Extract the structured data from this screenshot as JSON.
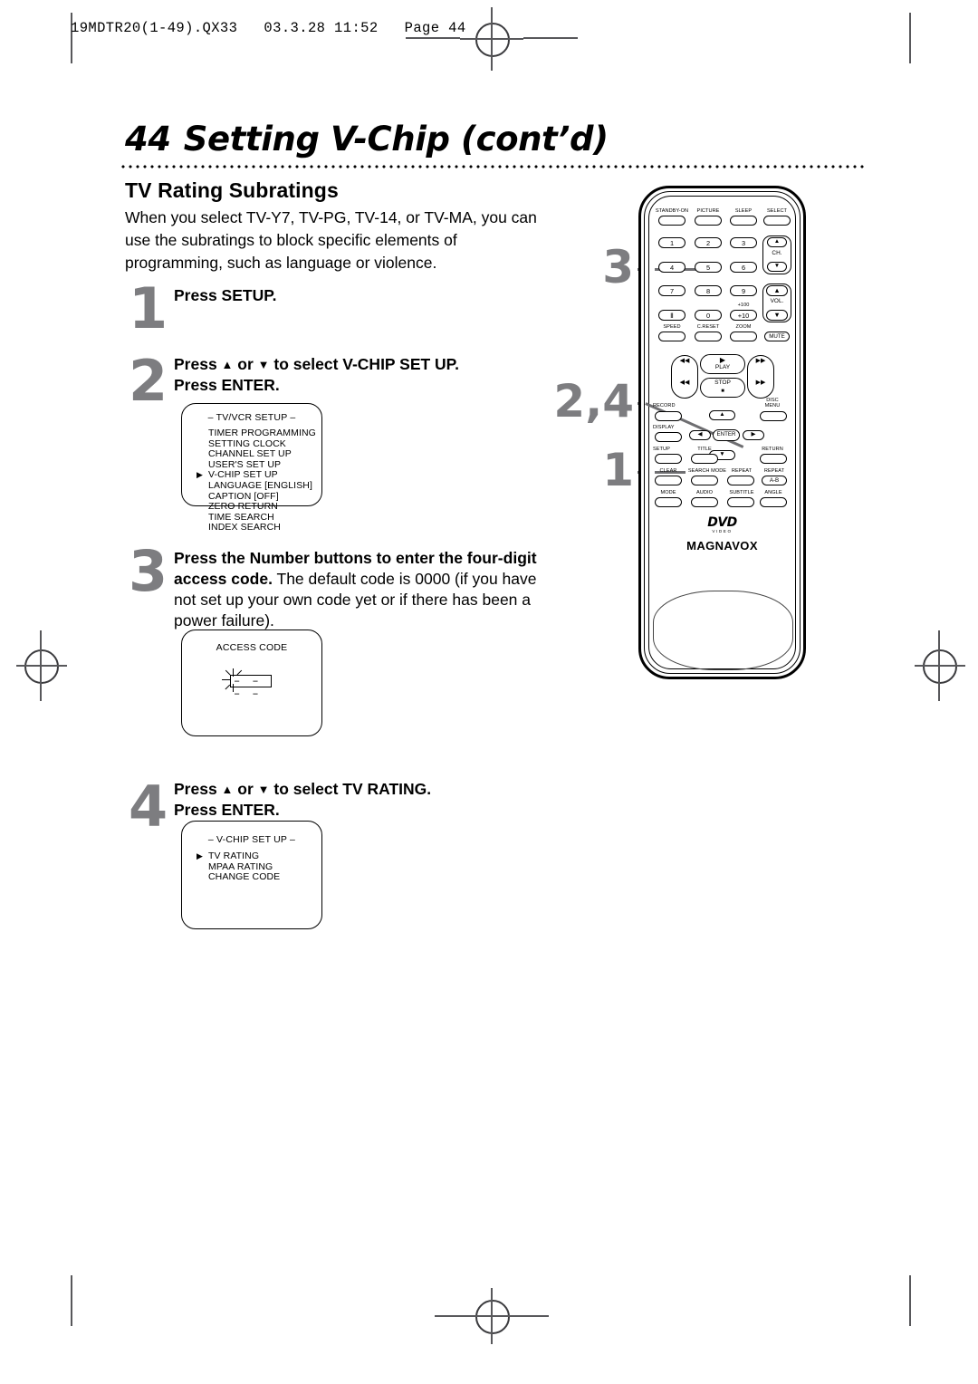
{
  "file_header": "19MDTR20(1-49).QX33   03.3.28 11:52   Page 44",
  "page": {
    "number": "44",
    "title": "Setting V-Chip (cont’d)",
    "section_heading": "TV Rating Subratings",
    "intro": "When you select TV-Y7, TV-PG, TV-14, or TV-MA, you can use the subratings to block specific elements of programming, such as language or violence."
  },
  "steps": [
    {
      "number": "1",
      "text_html": "Press SETUP."
    },
    {
      "number": "2",
      "line1_pre": "Press ",
      "line1_mid": " or ",
      "line1_post": " to select V-CHIP SET UP.",
      "line2": "Press ENTER."
    },
    {
      "number": "3",
      "bold": "Press the Number buttons to enter the four-digit access code.",
      "rest": " The default code is 0000 (if you have not set up your own code yet or if there has been a power failure)."
    },
    {
      "number": "4",
      "line1_pre": "Press ",
      "line1_mid": " or ",
      "line1_post": " to select TV RATING.",
      "line2": "Press ENTER."
    }
  ],
  "osd_tvvcr": {
    "title": "– TV/VCR SETUP –",
    "items": [
      {
        "label": "TIMER PROGRAMMING",
        "selected": false
      },
      {
        "label": "SETTING CLOCK",
        "selected": false
      },
      {
        "label": "CHANNEL SET UP",
        "selected": false
      },
      {
        "label": "USER'S SET UP",
        "selected": false
      },
      {
        "label": "V-CHIP SET UP",
        "selected": true
      },
      {
        "label": "LANGUAGE  [ENGLISH]",
        "selected": false
      },
      {
        "label": "CAPTION  [OFF]",
        "selected": false
      },
      {
        "label": "ZERO RETURN",
        "selected": false
      },
      {
        "label": "TIME SEARCH",
        "selected": false
      },
      {
        "label": "INDEX SEARCH",
        "selected": false
      }
    ]
  },
  "osd_access": {
    "title": "ACCESS CODE",
    "field_value": "–  –  –  –"
  },
  "osd_vchip": {
    "title": "– V-CHIP SET UP –",
    "items": [
      {
        "label": "TV RATING",
        "selected": true
      },
      {
        "label": "MPAA RATING",
        "selected": false
      },
      {
        "label": "CHANGE CODE",
        "selected": false
      }
    ]
  },
  "callouts": [
    {
      "id": "callout-3",
      "label": "3"
    },
    {
      "id": "callout-2-4",
      "label": "2,4"
    },
    {
      "id": "callout-1",
      "label": "1"
    }
  ],
  "remote": {
    "brand": "MAGNAVOX",
    "disc_logo_main": "DVD",
    "disc_logo_sub": "VIDEO",
    "row_top": [
      "STANDBY-ON",
      "PICTURE",
      "SLEEP",
      "SELECT"
    ],
    "numeric_keys": [
      "1",
      "2",
      "3",
      "4",
      "5",
      "6",
      "7",
      "8",
      "9",
      "Ⅱ",
      "0",
      "+10"
    ],
    "plus100": "+100",
    "ch_label": "CH.",
    "vol_label": "VOL.",
    "row_speed": [
      "SPEED",
      "C.RESET",
      "ZOOM"
    ],
    "mute": "MUTE",
    "transport": {
      "play": "PLAY",
      "stop": "STOP",
      "prev": "◀◀",
      "next": "▶▶",
      "skip_prev": "◀◀|",
      "skip_next": "|▶▶",
      "play_glyph": "▶",
      "stop_glyph": "■"
    },
    "row_record": [
      "RECORD",
      "DISC MENU"
    ],
    "row_display": [
      "DISPLAY"
    ],
    "row_setup": [
      "SETUP",
      "TITLE",
      "RETURN"
    ],
    "row_clear": [
      "CLEAR",
      "SEARCH MODE",
      "REPEAT",
      "REPEAT A-B"
    ],
    "repeat_ab": "A-B",
    "row_mode": [
      "MODE",
      "AUDIO",
      "SUBTITLE",
      "ANGLE"
    ],
    "enter": "ENTER",
    "arrows": {
      "up": "▲",
      "down": "▼",
      "left": "◀",
      "right": "▶"
    }
  },
  "colors": {
    "step_number": "#7d7d80",
    "leader": "#6e6e71",
    "ink": "#000000"
  }
}
